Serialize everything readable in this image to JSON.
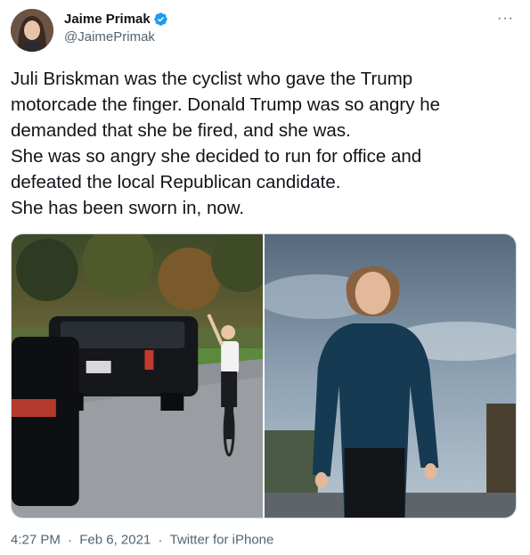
{
  "author": {
    "name": "Jaime Primak",
    "handle": "@JaimePrimak",
    "verified": true,
    "avatar_icon": "profile-photo-avatar"
  },
  "more_icon": "more-options-icon",
  "more_glyph": "···",
  "tweet_lines": [
    "Juli Briskman was the cyclist who gave the Trump",
    "motorcade the finger. Donald Trump was so angry he",
    "demanded that she be fired, and she was.",
    "She was so angry she decided to run for office and",
    "defeated the local Republican candidate.",
    "She has been sworn in, now."
  ],
  "media": {
    "photo_left": "cyclist beside motorcade photo",
    "photo_right": "woman portrait photo"
  },
  "meta": {
    "time": "4:27 PM",
    "date": "Feb 6, 2021",
    "source": "Twitter for iPhone",
    "separator": "·"
  },
  "colors": {
    "verified_blue": "#1d9bf0",
    "secondary_text": "#536471",
    "primary_text": "#0f1419"
  }
}
